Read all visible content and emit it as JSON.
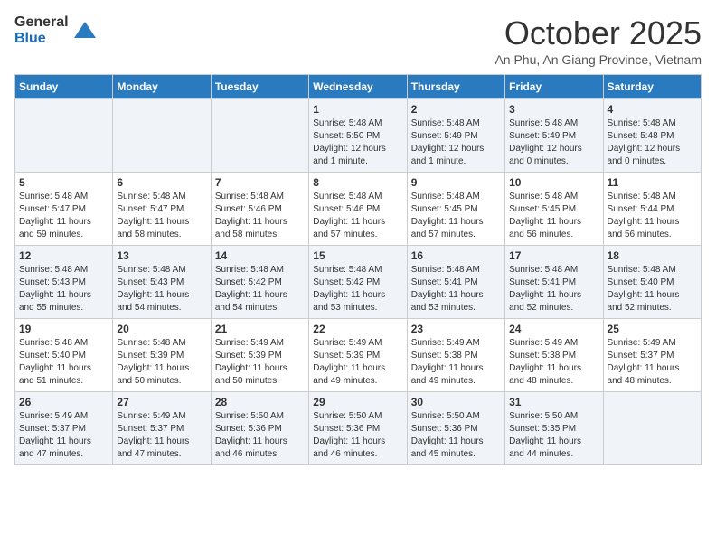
{
  "logo": {
    "general": "General",
    "blue": "Blue"
  },
  "title": "October 2025",
  "subtitle": "An Phu, An Giang Province, Vietnam",
  "days_of_week": [
    "Sunday",
    "Monday",
    "Tuesday",
    "Wednesday",
    "Thursday",
    "Friday",
    "Saturday"
  ],
  "weeks": [
    [
      {
        "day": "",
        "info": ""
      },
      {
        "day": "",
        "info": ""
      },
      {
        "day": "",
        "info": ""
      },
      {
        "day": "1",
        "info": "Sunrise: 5:48 AM\nSunset: 5:50 PM\nDaylight: 12 hours\nand 1 minute."
      },
      {
        "day": "2",
        "info": "Sunrise: 5:48 AM\nSunset: 5:49 PM\nDaylight: 12 hours\nand 1 minute."
      },
      {
        "day": "3",
        "info": "Sunrise: 5:48 AM\nSunset: 5:49 PM\nDaylight: 12 hours\nand 0 minutes."
      },
      {
        "day": "4",
        "info": "Sunrise: 5:48 AM\nSunset: 5:48 PM\nDaylight: 12 hours\nand 0 minutes."
      }
    ],
    [
      {
        "day": "5",
        "info": "Sunrise: 5:48 AM\nSunset: 5:47 PM\nDaylight: 11 hours\nand 59 minutes."
      },
      {
        "day": "6",
        "info": "Sunrise: 5:48 AM\nSunset: 5:47 PM\nDaylight: 11 hours\nand 58 minutes."
      },
      {
        "day": "7",
        "info": "Sunrise: 5:48 AM\nSunset: 5:46 PM\nDaylight: 11 hours\nand 58 minutes."
      },
      {
        "day": "8",
        "info": "Sunrise: 5:48 AM\nSunset: 5:46 PM\nDaylight: 11 hours\nand 57 minutes."
      },
      {
        "day": "9",
        "info": "Sunrise: 5:48 AM\nSunset: 5:45 PM\nDaylight: 11 hours\nand 57 minutes."
      },
      {
        "day": "10",
        "info": "Sunrise: 5:48 AM\nSunset: 5:45 PM\nDaylight: 11 hours\nand 56 minutes."
      },
      {
        "day": "11",
        "info": "Sunrise: 5:48 AM\nSunset: 5:44 PM\nDaylight: 11 hours\nand 56 minutes."
      }
    ],
    [
      {
        "day": "12",
        "info": "Sunrise: 5:48 AM\nSunset: 5:43 PM\nDaylight: 11 hours\nand 55 minutes."
      },
      {
        "day": "13",
        "info": "Sunrise: 5:48 AM\nSunset: 5:43 PM\nDaylight: 11 hours\nand 54 minutes."
      },
      {
        "day": "14",
        "info": "Sunrise: 5:48 AM\nSunset: 5:42 PM\nDaylight: 11 hours\nand 54 minutes."
      },
      {
        "day": "15",
        "info": "Sunrise: 5:48 AM\nSunset: 5:42 PM\nDaylight: 11 hours\nand 53 minutes."
      },
      {
        "day": "16",
        "info": "Sunrise: 5:48 AM\nSunset: 5:41 PM\nDaylight: 11 hours\nand 53 minutes."
      },
      {
        "day": "17",
        "info": "Sunrise: 5:48 AM\nSunset: 5:41 PM\nDaylight: 11 hours\nand 52 minutes."
      },
      {
        "day": "18",
        "info": "Sunrise: 5:48 AM\nSunset: 5:40 PM\nDaylight: 11 hours\nand 52 minutes."
      }
    ],
    [
      {
        "day": "19",
        "info": "Sunrise: 5:48 AM\nSunset: 5:40 PM\nDaylight: 11 hours\nand 51 minutes."
      },
      {
        "day": "20",
        "info": "Sunrise: 5:48 AM\nSunset: 5:39 PM\nDaylight: 11 hours\nand 50 minutes."
      },
      {
        "day": "21",
        "info": "Sunrise: 5:49 AM\nSunset: 5:39 PM\nDaylight: 11 hours\nand 50 minutes."
      },
      {
        "day": "22",
        "info": "Sunrise: 5:49 AM\nSunset: 5:39 PM\nDaylight: 11 hours\nand 49 minutes."
      },
      {
        "day": "23",
        "info": "Sunrise: 5:49 AM\nSunset: 5:38 PM\nDaylight: 11 hours\nand 49 minutes."
      },
      {
        "day": "24",
        "info": "Sunrise: 5:49 AM\nSunset: 5:38 PM\nDaylight: 11 hours\nand 48 minutes."
      },
      {
        "day": "25",
        "info": "Sunrise: 5:49 AM\nSunset: 5:37 PM\nDaylight: 11 hours\nand 48 minutes."
      }
    ],
    [
      {
        "day": "26",
        "info": "Sunrise: 5:49 AM\nSunset: 5:37 PM\nDaylight: 11 hours\nand 47 minutes."
      },
      {
        "day": "27",
        "info": "Sunrise: 5:49 AM\nSunset: 5:37 PM\nDaylight: 11 hours\nand 47 minutes."
      },
      {
        "day": "28",
        "info": "Sunrise: 5:50 AM\nSunset: 5:36 PM\nDaylight: 11 hours\nand 46 minutes."
      },
      {
        "day": "29",
        "info": "Sunrise: 5:50 AM\nSunset: 5:36 PM\nDaylight: 11 hours\nand 46 minutes."
      },
      {
        "day": "30",
        "info": "Sunrise: 5:50 AM\nSunset: 5:36 PM\nDaylight: 11 hours\nand 45 minutes."
      },
      {
        "day": "31",
        "info": "Sunrise: 5:50 AM\nSunset: 5:35 PM\nDaylight: 11 hours\nand 44 minutes."
      },
      {
        "day": "",
        "info": ""
      }
    ]
  ]
}
